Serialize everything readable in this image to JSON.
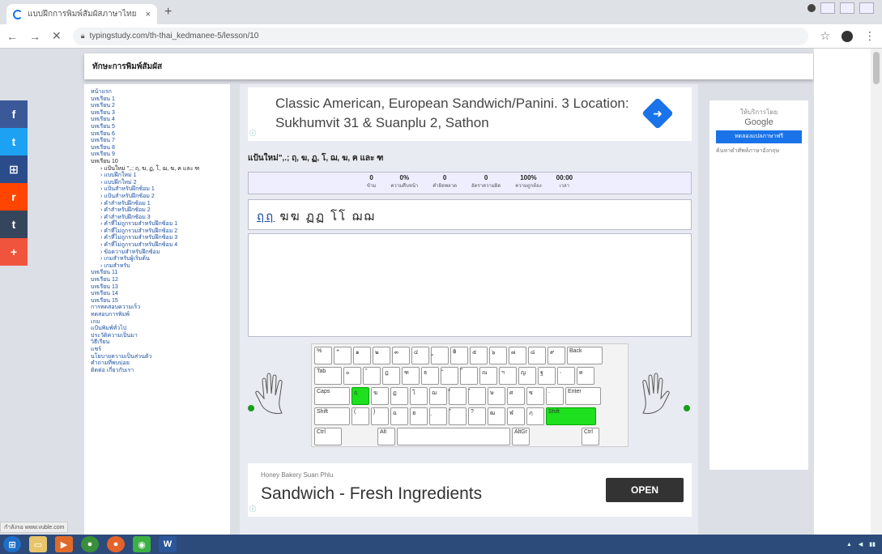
{
  "browser": {
    "tab_title": "แบบฝึกการพิมพ์สัมผัสภาษาไทย",
    "tab_close": "×",
    "new_tab": "+",
    "url": "typingstudy.com/th-thai_kedmanee-5/lesson/10",
    "nav": {
      "back": "←",
      "forward": "→",
      "reload": "✕"
    },
    "star": "☆",
    "menu": "⋮"
  },
  "header": {
    "title": "ทักษะการพิมพ์สัมผัส"
  },
  "sidebar": {
    "items": [
      {
        "label": "หน้าแรก",
        "sub": false,
        "current": false
      },
      {
        "label": "บทเรียน 1",
        "sub": false,
        "current": false
      },
      {
        "label": "บทเรียน 2",
        "sub": false,
        "current": false
      },
      {
        "label": "บทเรียน 3",
        "sub": false,
        "current": false
      },
      {
        "label": "บทเรียน 4",
        "sub": false,
        "current": false
      },
      {
        "label": "บทเรียน 5",
        "sub": false,
        "current": false
      },
      {
        "label": "บทเรียน 6",
        "sub": false,
        "current": false
      },
      {
        "label": "บทเรียน 7",
        "sub": false,
        "current": false
      },
      {
        "label": "บทเรียน 8",
        "sub": false,
        "current": false
      },
      {
        "label": "บทเรียน 9",
        "sub": false,
        "current": false
      },
      {
        "label": "บทเรียน 10",
        "sub": false,
        "current": true
      },
      {
        "label": "› แป้นใหม่ \",.; ฤ, ฆ, ฏ, โ, ฌ, ฆ, ฅ และ ฑ",
        "sub": true,
        "current": true
      },
      {
        "label": "› แบบฝึกใหม่ 1",
        "sub": true,
        "current": false
      },
      {
        "label": "› แบบฝึกใหม่ 2",
        "sub": true,
        "current": false
      },
      {
        "label": "› แป้นสำหรับฝึกซ้อม 1",
        "sub": true,
        "current": false
      },
      {
        "label": "› แป้นสำหรับฝึกซ้อม 2",
        "sub": true,
        "current": false
      },
      {
        "label": "› คำสำหรับฝึกซ้อม 1",
        "sub": true,
        "current": false
      },
      {
        "label": "› คำสำหรับฝึกซ้อม 2",
        "sub": true,
        "current": false
      },
      {
        "label": "› คำสำหรับฝึกซ้อม 3",
        "sub": true,
        "current": false
      },
      {
        "label": "› คำที่ไม่ถูกรวมสำหรับฝึกซ้อม 1",
        "sub": true,
        "current": false
      },
      {
        "label": "› คำที่ไม่ถูกรวมสำหรับฝึกซ้อม 2",
        "sub": true,
        "current": false
      },
      {
        "label": "› คำที่ไม่ถูกรวมสำหรับฝึกซ้อม 3",
        "sub": true,
        "current": false
      },
      {
        "label": "› คำที่ไม่ถูกรวมสำหรับฝึกซ้อม 4",
        "sub": true,
        "current": false
      },
      {
        "label": "› ข้อความสำหรับฝึกซ้อม",
        "sub": true,
        "current": false
      },
      {
        "label": "› เกมสำหรับผู้เริ่มต้น",
        "sub": true,
        "current": false
      },
      {
        "label": "› เกมสำหรับ",
        "sub": true,
        "current": false
      },
      {
        "label": "บทเรียน 11",
        "sub": false,
        "current": false
      },
      {
        "label": "บทเรียน 12",
        "sub": false,
        "current": false
      },
      {
        "label": "บทเรียน 13",
        "sub": false,
        "current": false
      },
      {
        "label": "บทเรียน 14",
        "sub": false,
        "current": false
      },
      {
        "label": "บทเรียน 15",
        "sub": false,
        "current": false
      },
      {
        "label": "การทดสอบความเร็ว",
        "sub": false,
        "current": false
      },
      {
        "label": "ทดสอบการพิมพ์",
        "sub": false,
        "current": false
      },
      {
        "label": "เกม",
        "sub": false,
        "current": false
      },
      {
        "label": "แป้นพิมพ์ทั่วไป",
        "sub": false,
        "current": false
      },
      {
        "label": "ประวัติความเป็นมา",
        "sub": false,
        "current": false
      },
      {
        "label": "วิธีเรียน",
        "sub": false,
        "current": false
      },
      {
        "label": "แชร์",
        "sub": false,
        "current": false
      },
      {
        "label": "นโยบายความเป็นส่วนตัว",
        "sub": false,
        "current": false
      },
      {
        "label": "คำถามที่พบบ่อย",
        "sub": false,
        "current": false
      },
      {
        "label": "ติดต่อ เกี่ยวกับเรา",
        "sub": false,
        "current": false
      }
    ]
  },
  "ad_top": {
    "text": "Classic American, European Sandwich/Panini. 3 Location: Sukhumvit 31 & Suanplu 2, Sathon",
    "info": "ⓘ",
    "arrow": "➜"
  },
  "lesson": {
    "title": "แป้นใหม่\",.; ฤ, ฆ, ฏ, โ, ฌ, ฆ, ฅ และ ฑ",
    "stats": [
      {
        "value": "0",
        "label": "ข้าม"
      },
      {
        "value": "0%",
        "label": "ความคืบหน้า"
      },
      {
        "value": "0",
        "label": "คำผิดพลาด"
      },
      {
        "value": "0",
        "label": "อัตราความผิด"
      },
      {
        "value": "100%",
        "label": "ความถูกต้อง"
      },
      {
        "value": "00:00",
        "label": "เวลา"
      }
    ],
    "first_word": "ฤฤ",
    "rest_line": "ฆฆ ฏฏ โโ ฌฌ"
  },
  "keyboard": {
    "row1": [
      "%",
      "+",
      "๑",
      "๒",
      "๓",
      "๔",
      "ู",
      "฿",
      "๕",
      "๖",
      "๗",
      "๘",
      "๙"
    ],
    "row1_end": "Back",
    "tab": "Tab",
    "row2": [
      "๐",
      "\"",
      "ฎ",
      "ฑ",
      "ธ",
      "ํ",
      "๊",
      "ณ",
      "ฯ",
      "ญ",
      "ฐ",
      ","
    ],
    "row2_end": "ฅ",
    "caps": "Caps",
    "row3": [
      "ฤ",
      "ฆ",
      "ฏ",
      "โ",
      "ฌ",
      "็",
      "๋",
      "ษ",
      "ศ",
      "ซ",
      "."
    ],
    "enter": "Enter",
    "shift": "Shift",
    "row4": [
      "(",
      ")",
      "ฉ",
      "ฮ",
      "ฺ",
      "์",
      "?",
      "ฒ",
      "ฬ",
      "ฦ"
    ],
    "shift_r": "Shift",
    "ctrl": "Ctrl",
    "alt": "Alt",
    "altgr": "AltGr",
    "ctrl_r": "Ctrl"
  },
  "ad_bottom": {
    "small": "Honey Bakery Suan Phlu",
    "big": "Sandwich - Fresh Ingredients",
    "cta": "OPEN",
    "info": "ⓘ"
  },
  "right_gadget": {
    "label": "ให้บริการโดย",
    "brand": "Google",
    "button": "ทดลองแปลภาษาฟรี",
    "alt": "ค้นหาคำศัพท์ภาษาอังกฤษ"
  },
  "social": [
    {
      "glyph": "f",
      "color": "#3b5998"
    },
    {
      "glyph": "t",
      "color": "#1da1f2"
    },
    {
      "glyph": "⊞",
      "color": "#2a4c8a"
    },
    {
      "glyph": "r",
      "color": "#ff4500"
    },
    {
      "glyph": "t",
      "color": "#35465c"
    },
    {
      "glyph": "+",
      "color": "#f0543c"
    }
  ],
  "statusbar": "กำลังรอ www.vuble.com",
  "taskbar": {
    "word": "W"
  }
}
